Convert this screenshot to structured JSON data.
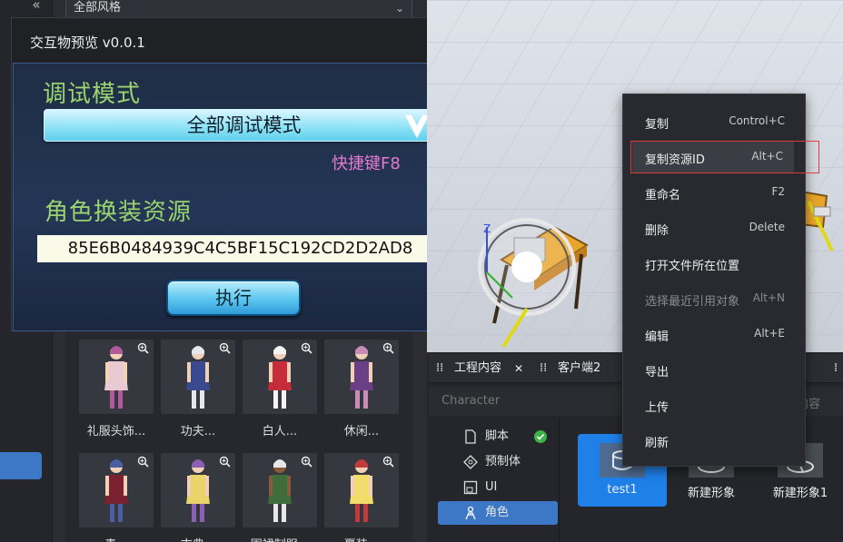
{
  "left_panel": {
    "collapse_glyph": "«",
    "style_filter": "全部风格",
    "thumbnails": [
      {
        "label": "礼服头饰...",
        "palette": [
          "#e9c9d2",
          "#b05a9a",
          "#f3d2b6"
        ]
      },
      {
        "label": "功夫...",
        "palette": [
          "#3b4a8e",
          "#e6e6ee",
          "#f0d0b8"
        ]
      },
      {
        "label": "白人...",
        "palette": [
          "#c52d3a",
          "#f4f4f4",
          "#f0d0b8"
        ]
      },
      {
        "label": "休闲...",
        "palette": [
          "#6b3f86",
          "#c98bb8",
          "#f0d0b8"
        ]
      },
      {
        "label": "毒...",
        "palette": [
          "#7a2230",
          "#4b5ea4",
          "#f0d0b8"
        ]
      },
      {
        "label": "古典...",
        "palette": [
          "#e9d36b",
          "#8b5fb3",
          "#f0d0b8"
        ]
      },
      {
        "label": "围裙制服...",
        "palette": [
          "#3f6d3c",
          "#e7e7e7",
          "#8a5a3c"
        ]
      },
      {
        "label": "夏装...",
        "palette": [
          "#f0dd6c",
          "#c33a3a",
          "#f0d0b8"
        ]
      }
    ]
  },
  "dialog": {
    "title": "交互物预览 v0.0.1",
    "close_glyph": "✕",
    "debug_heading": "调试模式",
    "debug_mode_value": "全部调试模式",
    "shortcut_hint": "快捷键F8",
    "skin_heading": "角色换装资源",
    "skin_resource_id": "85E6B0484939C4C5BF15C192CD2D2AD8",
    "execute_label": "执行"
  },
  "project_panel": {
    "tabs": [
      {
        "label": "工程内容",
        "closable": true
      },
      {
        "label": "客户端2",
        "closable": false
      }
    ],
    "close_glyph": "✕",
    "search_placeholder": "Character",
    "search_tail": "索内容",
    "tree": [
      {
        "label": "脚本",
        "icon": "file-icon",
        "active": false,
        "status": "ok"
      },
      {
        "label": "预制体",
        "icon": "prefab-icon",
        "active": false
      },
      {
        "label": "UI",
        "icon": "ui-icon",
        "active": false
      },
      {
        "label": "角色",
        "icon": "character-icon",
        "active": true
      }
    ],
    "assets": [
      {
        "name": "test1",
        "selected": true
      },
      {
        "name": "新建形象",
        "selected": false
      },
      {
        "name": "新建形象1",
        "selected": false
      }
    ]
  },
  "context_menu": {
    "items": [
      {
        "label": "复制",
        "shortcut": "Control+C",
        "disabled": false
      },
      {
        "label": "复制资源ID",
        "shortcut": "Alt+C",
        "disabled": false,
        "hover": true
      },
      {
        "label": "重命名",
        "shortcut": "F2",
        "disabled": false
      },
      {
        "label": "删除",
        "shortcut": "Delete",
        "disabled": false
      },
      {
        "label": "打开文件所在位置",
        "shortcut": "",
        "disabled": false
      },
      {
        "label": "选择最近引用对象",
        "shortcut": "Alt+N",
        "disabled": true
      },
      {
        "label": "编辑",
        "shortcut": "Alt+E",
        "disabled": false
      },
      {
        "label": "导出",
        "shortcut": "",
        "disabled": false
      },
      {
        "label": "上传",
        "shortcut": "",
        "disabled": false
      },
      {
        "label": "刷新",
        "shortcut": "",
        "disabled": false
      }
    ]
  },
  "viewport": {
    "axis_label": "Z"
  },
  "colors": {
    "accent": "#3d78c6",
    "success": "#3cb44b",
    "highlight_outline": "#e23a3a",
    "heading_green": "#9bd36e",
    "shortcut_pink": "#e57ad0"
  }
}
